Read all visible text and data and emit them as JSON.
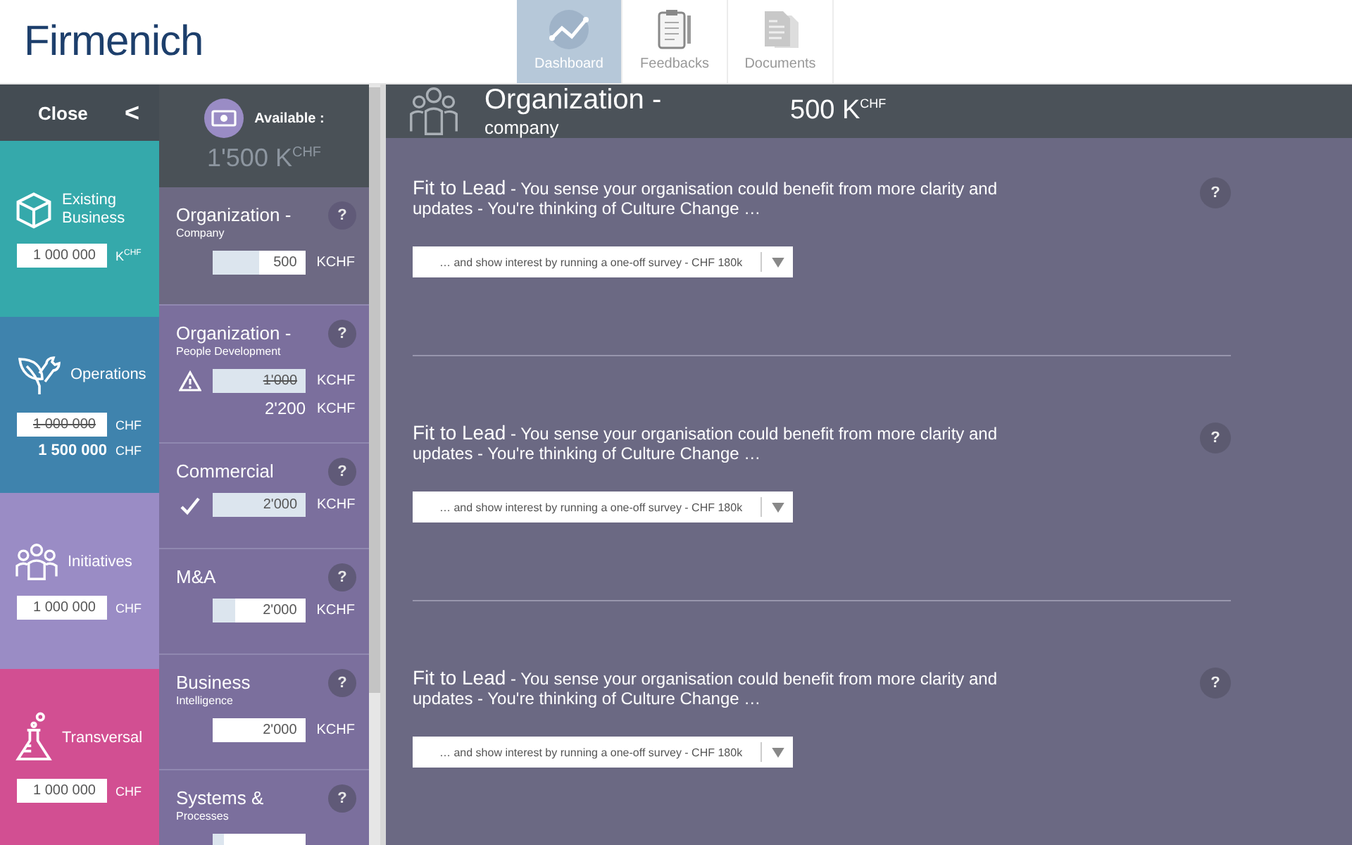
{
  "header": {
    "logo": "Firmenich",
    "tabs": [
      {
        "label": "Dashboard",
        "selected": true
      },
      {
        "label": "Feedbacks",
        "selected": false
      },
      {
        "label": "Documents",
        "selected": false
      }
    ]
  },
  "sidebar": {
    "close": "Close",
    "toggle": "<",
    "categories": [
      {
        "name": "Existing Business",
        "color": "#35a9ab",
        "value": "1 000 000",
        "unit": "K$^{CHF}$",
        "struck": false
      },
      {
        "name": "Operations",
        "color": "#3f83ad",
        "value": "1 000 000",
        "unit": "CHF",
        "struck": true,
        "revised": "1 500 000",
        "revised_unit": "CHF"
      },
      {
        "name": "Initiatives",
        "color": "#9a8cc5",
        "value": "1 000 000",
        "unit": "CHF",
        "struck": false
      },
      {
        "name": "Transversal",
        "color": "#d24f92",
        "value": "1 000 000",
        "unit": "CHF",
        "struck": false
      }
    ]
  },
  "budget": {
    "label": "Available :",
    "amount": "1'500 K$^{CHF}$",
    "items": [
      {
        "title": "Organization -",
        "subtitle": "Company",
        "value": "500",
        "unit": "KCHF",
        "level": 0.5,
        "struck": false,
        "warning": false,
        "checked": false,
        "selected": true,
        "help": "?"
      },
      {
        "title": "Organization -",
        "subtitle": "People Development",
        "value": "1'000",
        "unit": "KCHF",
        "level": 1,
        "struck": true,
        "revised": "2'200",
        "revised_unit": "KCHF",
        "warning": true,
        "checked": false,
        "selected": false,
        "help": "?"
      },
      {
        "title": "Commercial",
        "value": "2'000",
        "unit": "KCHF",
        "level": 1,
        "struck": false,
        "warning": false,
        "checked": true,
        "selected": false,
        "help": "?"
      },
      {
        "title": "M&A",
        "value": "2'000",
        "unit": "KCHF",
        "level": 0.25,
        "struck": false,
        "warning": false,
        "checked": false,
        "selected": false,
        "help": "?"
      },
      {
        "title": "Business",
        "subtitle": "Intelligence",
        "value": "2'000",
        "unit": "KCHF",
        "struck": false,
        "warning": false,
        "checked": false,
        "selected": false,
        "help": "?"
      },
      {
        "title": "Systems &",
        "subtitle": "Processes",
        "level": 0.12,
        "warning": false,
        "checked": false,
        "selected": false,
        "help": "?"
      }
    ]
  },
  "detail": {
    "title": "Organization -",
    "subtitle": "company",
    "amount": "500 K$^{CHF}$",
    "questions": [
      {
        "lead": "Fit to Lead",
        "text": "- You sense your organisation could benefit from more clarity and updates - You're thinking of Culture Change …",
        "choice": "… and show interest by running a one-off survey - CHF 180k",
        "help": "?"
      },
      {
        "lead": "Fit to Lead",
        "text": "- You sense your organisation could benefit from more clarity and updates - You're thinking of Culture Change …",
        "choice": "… and show interest by running a one-off survey - CHF 180k",
        "help": "?"
      },
      {
        "lead": "Fit to Lead",
        "text": "- You sense your organisation could benefit from more clarity and updates - You're thinking of Culture Change …",
        "choice": "… and show interest by running a one-off survey - CHF 180k",
        "help": "?"
      }
    ]
  }
}
